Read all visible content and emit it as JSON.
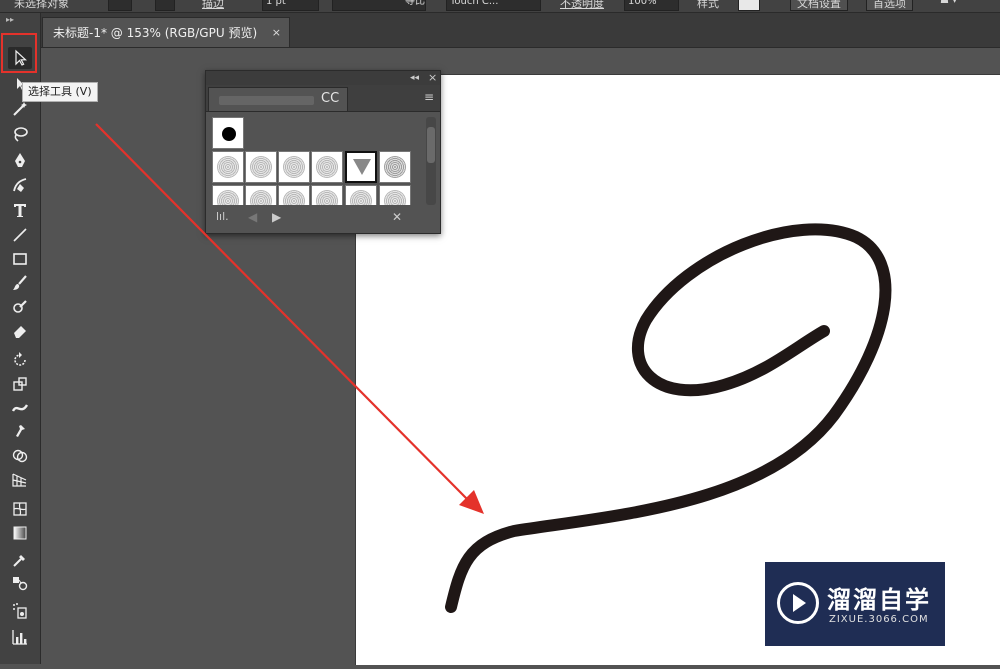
{
  "control_bar": {
    "items": [
      "未选择对象",
      "描边",
      "1 pt",
      "等比",
      "Touch C...",
      "不透明度",
      "100%",
      "样式",
      "文档设置",
      "首选项"
    ]
  },
  "document_tab": {
    "title": "未标题-1* @ 153% (RGB/GPU 预览)",
    "close_glyph": "×"
  },
  "toolbar": {
    "grip_glyph": "▸▸",
    "tools": [
      {
        "name": "tool-selection",
        "icon": "selection-arrow-icon"
      },
      {
        "name": "tool-direct-selection",
        "icon": "direct-selection-icon"
      },
      {
        "name": "tool-magic-wand",
        "icon": "magic-wand-icon"
      },
      {
        "name": "tool-lasso",
        "icon": "lasso-icon"
      },
      {
        "name": "tool-pen",
        "icon": "pen-icon"
      },
      {
        "name": "tool-curvature",
        "icon": "curvature-icon"
      },
      {
        "name": "tool-type",
        "icon": "type-icon"
      },
      {
        "name": "tool-line",
        "icon": "line-icon"
      },
      {
        "name": "tool-rectangle",
        "icon": "rectangle-icon"
      },
      {
        "name": "tool-paintbrush",
        "icon": "paintbrush-icon"
      },
      {
        "name": "tool-blob-brush",
        "icon": "blob-brush-icon"
      },
      {
        "name": "tool-eraser",
        "icon": "eraser-icon"
      },
      {
        "name": "tool-rotate",
        "icon": "rotate-icon"
      },
      {
        "name": "tool-scale",
        "icon": "scale-icon"
      },
      {
        "name": "tool-width",
        "icon": "width-icon"
      },
      {
        "name": "tool-puppet-warp",
        "icon": "puppet-warp-icon"
      },
      {
        "name": "tool-shape-builder",
        "icon": "shape-builder-icon"
      },
      {
        "name": "tool-perspective-grid",
        "icon": "perspective-grid-icon"
      },
      {
        "name": "tool-mesh",
        "icon": "mesh-icon"
      },
      {
        "name": "tool-gradient",
        "icon": "gradient-icon"
      },
      {
        "name": "tool-eyedropper",
        "icon": "eyedropper-icon"
      },
      {
        "name": "tool-blend",
        "icon": "blend-icon"
      },
      {
        "name": "tool-symbol-sprayer",
        "icon": "symbol-sprayer-icon"
      },
      {
        "name": "tool-column-graph",
        "icon": "column-graph-icon"
      }
    ]
  },
  "tooltip": {
    "text": "选择工具 (V)"
  },
  "brushes_panel": {
    "tab_label": "CC",
    "collapse_glyph": "◂◂",
    "close_glyph": "×",
    "menu_glyph": "≡",
    "footer_icons": [
      "brush-library-icon",
      "prev-arrow-icon",
      "next-arrow-icon",
      "remove-brush-icon"
    ],
    "library_glyph": "lıl.",
    "prev_glyph": "◀",
    "next_glyph": "▶",
    "remove_glyph": "✕"
  },
  "annotation": {
    "highlight_color": "#e4322b",
    "arrow_color": "#e4322b"
  },
  "artwork": {
    "stroke_color": "#1f1716"
  },
  "watermark": {
    "title": "溜溜自学",
    "subtitle": "ZIXUE.3066.COM",
    "bg_color": "#1f2d54"
  }
}
